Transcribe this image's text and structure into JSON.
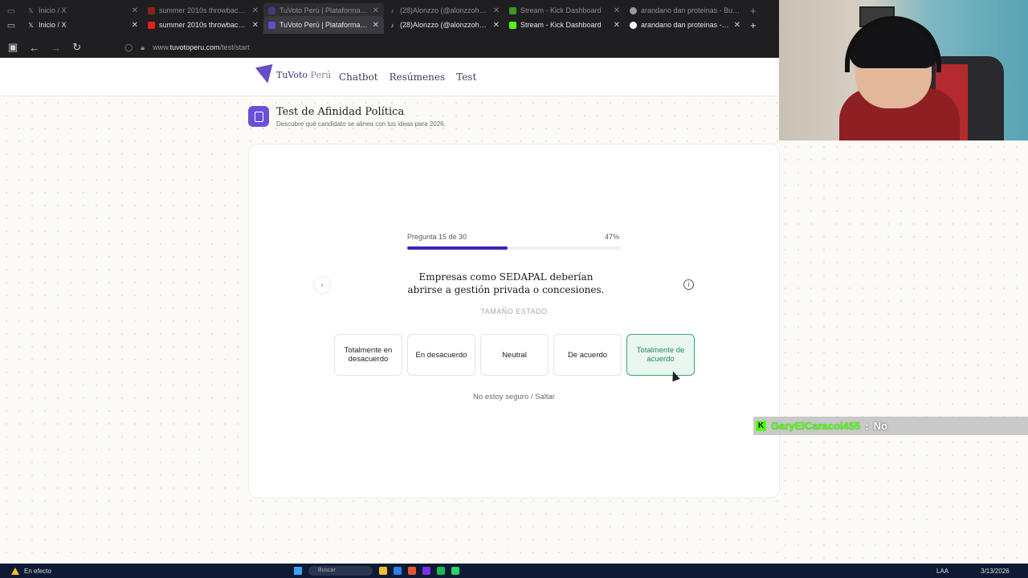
{
  "browser": {
    "ghost_tabs": [
      {
        "title": "Inicio / X",
        "icon": "x-logo-icon"
      },
      {
        "title": "summer 2010s throwback | 201",
        "icon": "youtube-icon"
      },
      {
        "title": "TuVoto Perú | Plataforma Electo",
        "icon": "tuvoto-icon"
      },
      {
        "title": "(28)Alonzzo (@alonzzoh_) | Tik",
        "icon": "tiktok-icon"
      },
      {
        "title": "Stream - Kick Dashboard",
        "icon": "kick-icon"
      },
      {
        "title": "arandano dan proteinas - Busca",
        "icon": "google-icon"
      }
    ],
    "tabs": [
      {
        "title": "Inicio / X",
        "icon": "x-logo-icon"
      },
      {
        "title": "summer 2010s throwback | 201",
        "icon": "youtube-icon"
      },
      {
        "title": "TuVoto Perú | Plataforma Electo",
        "icon": "tuvoto-icon"
      },
      {
        "title": "(28)Alonzzo (@alonzzoh_) | Tik",
        "icon": "tiktok-icon"
      },
      {
        "title": "Stream - Kick Dashboard",
        "icon": "kick-icon"
      },
      {
        "title": "arandano dan proteinas - Busca",
        "icon": "google-icon"
      }
    ],
    "url_prefix": "www.",
    "url_domain": "tuvotoperu.com",
    "url_path": "/test/start"
  },
  "site": {
    "logo_primary": "TuVoto",
    "logo_secondary": "Perú",
    "nav": [
      "Chatbot",
      "Resúmenes",
      "Test"
    ]
  },
  "page": {
    "title": "Test de Afinidad Política",
    "subtitle": "Descubre qué candidato se alinea con tus ideas para 2026."
  },
  "quiz": {
    "progress_label": "Pregunta 15 de 30",
    "progress_pct_label": "47%",
    "progress": 0.47,
    "question": "Empresas como SEDAPAL deberían abrirse a gestión privada o concesiones.",
    "category": "TAMAÑO ESTADO",
    "options": [
      "Totalmente en desacuerdo",
      "En desacuerdo",
      "Neutral",
      "De acuerdo",
      "Totalmente de acuerdo"
    ],
    "selected_index": 4,
    "skip": "No estoy seguro / Saltar"
  },
  "chat_overlay": {
    "user": "GaryElCaracol455",
    "separator": ":",
    "message": "No"
  },
  "taskbar": {
    "status": "En efecto",
    "search": "Buscar",
    "lang": "LAA",
    "date": "3/13/2026"
  },
  "colors": {
    "accent": "#3b23b8",
    "selected_border": "#3aa679",
    "kick_green": "#53fc18"
  }
}
